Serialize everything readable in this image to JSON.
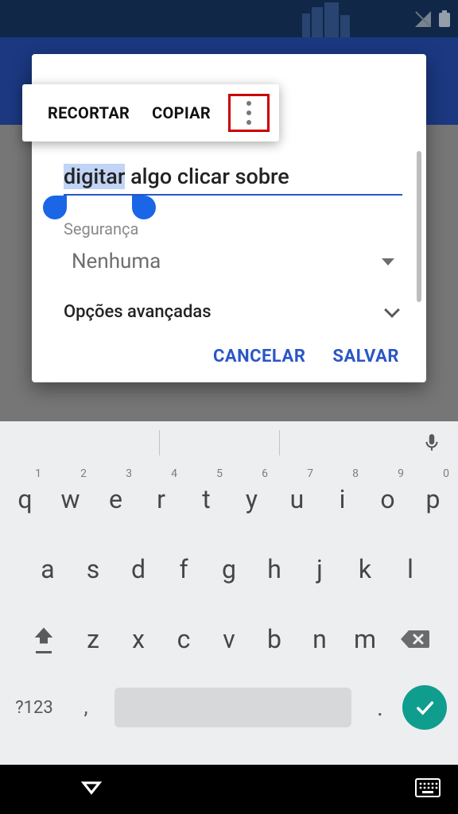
{
  "context_menu": {
    "cut": "RECORTAR",
    "copy": "COPIAR"
  },
  "input": {
    "selected": "digitar",
    "rest": " algo clicar sobre"
  },
  "security": {
    "label": "Segurança",
    "selected": "Nenhuma"
  },
  "advanced": {
    "label": "Opções avançadas"
  },
  "actions": {
    "cancel": "CANCELAR",
    "save": "SALVAR"
  },
  "keyboard": {
    "row1": [
      "q",
      "w",
      "e",
      "r",
      "t",
      "y",
      "u",
      "i",
      "o",
      "p"
    ],
    "row1_nums": [
      "1",
      "2",
      "3",
      "4",
      "5",
      "6",
      "7",
      "8",
      "9",
      "0"
    ],
    "row2": [
      "a",
      "s",
      "d",
      "f",
      "g",
      "h",
      "j",
      "k",
      "l"
    ],
    "row3": [
      "z",
      "x",
      "c",
      "v",
      "b",
      "n",
      "m"
    ],
    "symbols_key": "?123",
    "comma": ",",
    "dot": "."
  }
}
